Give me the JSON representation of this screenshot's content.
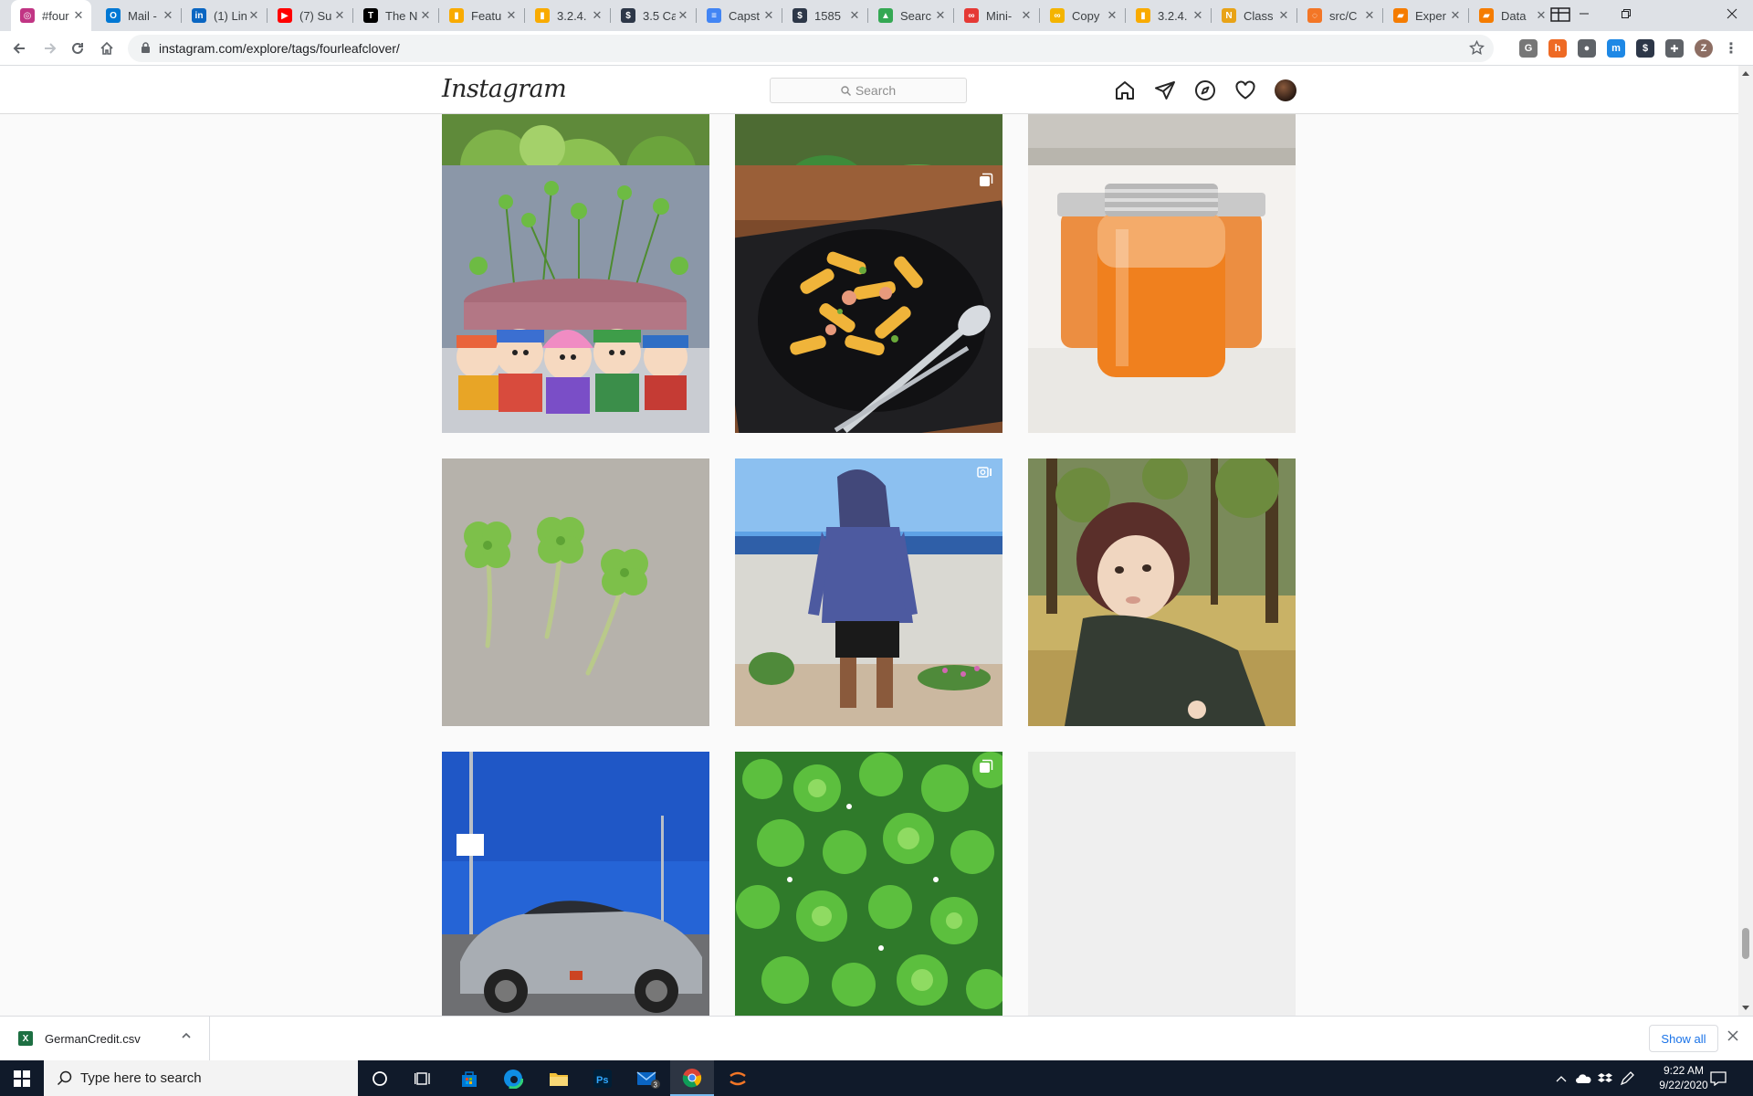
{
  "browser": {
    "tabs": [
      {
        "title": "#four",
        "color": "#c13584",
        "glyph": "◎",
        "active": true
      },
      {
        "title": "Mail -",
        "color": "#0078d4",
        "glyph": "O"
      },
      {
        "title": "(1) Lin",
        "color": "#0a66c2",
        "glyph": "in"
      },
      {
        "title": "(7) Su",
        "color": "#ff0000",
        "glyph": "▶"
      },
      {
        "title": "The N",
        "color": "#000000",
        "glyph": "T"
      },
      {
        "title": "Featu",
        "color": "#f9ab00",
        "glyph": "▮"
      },
      {
        "title": "3.2.4.",
        "color": "#f9ab00",
        "glyph": "▮"
      },
      {
        "title": "3.5 Ca",
        "color": "#2d3748",
        "glyph": "$"
      },
      {
        "title": "Capst",
        "color": "#4285f4",
        "glyph": "≡"
      },
      {
        "title": "1585",
        "color": "#2d3748",
        "glyph": "$"
      },
      {
        "title": "Searc",
        "color": "#34a853",
        "glyph": "▲"
      },
      {
        "title": "Mini-",
        "color": "#e53935",
        "glyph": "∞"
      },
      {
        "title": "Copy",
        "color": "#f4b400",
        "glyph": "∞"
      },
      {
        "title": "3.2.4.",
        "color": "#f9ab00",
        "glyph": "▮"
      },
      {
        "title": "Class",
        "color": "#e8a317",
        "glyph": "N"
      },
      {
        "title": "src/C",
        "color": "#f37626",
        "glyph": "◌"
      },
      {
        "title": "Exper",
        "color": "#f57c00",
        "glyph": "▰"
      },
      {
        "title": "Data",
        "color": "#f57c00",
        "glyph": "▰"
      }
    ],
    "url": "instagram.com/explore/tags/fourleafclover/",
    "extensions": [
      {
        "name": "grammarly-icon",
        "color": "#777777",
        "glyph": "G"
      },
      {
        "name": "honey-icon",
        "color": "#ee6a24",
        "glyph": "h"
      },
      {
        "name": "circle-ext-icon",
        "color": "#5f6368",
        "glyph": "●"
      },
      {
        "name": "m-ext-icon",
        "color": "#1e88e5",
        "glyph": "m"
      },
      {
        "name": "dollar-ext-icon",
        "color": "#2d3748",
        "glyph": "$"
      },
      {
        "name": "puzzle-icon",
        "color": "#5f6368",
        "glyph": "✚"
      }
    ],
    "profile_initial": "Z"
  },
  "instagram": {
    "logo": "Instagram",
    "search_placeholder": "Search"
  },
  "download": {
    "file_name": "GermanCredit.csv",
    "file_glyph": "X",
    "show_all": "Show all"
  },
  "taskbar": {
    "search_placeholder": "Type here to search",
    "mail_badge": "3",
    "time": "9:22 AM",
    "date": "9/22/2020"
  },
  "colors": {
    "chrome_strip": "#dee1e6",
    "ig_border": "#dbdbdb",
    "taskbar": "#101a2a",
    "link_blue": "#1a73e8"
  }
}
